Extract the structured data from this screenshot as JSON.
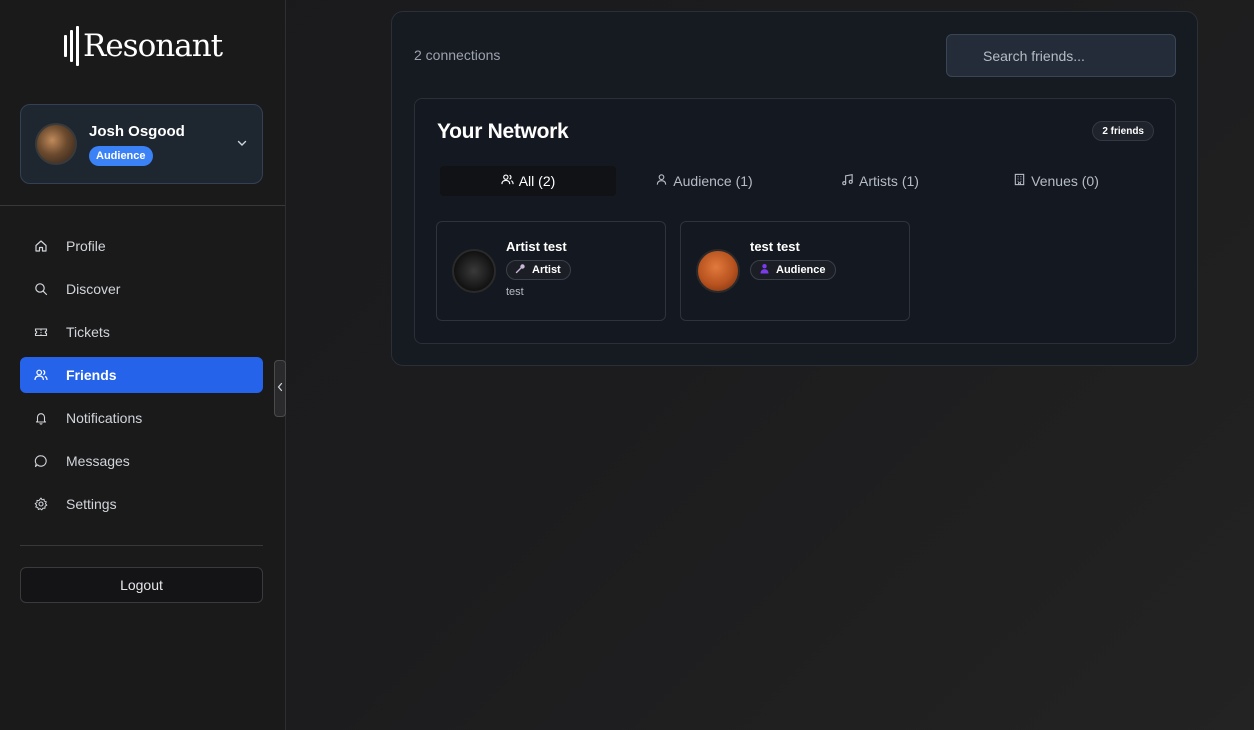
{
  "app": {
    "logo_text": "Resonant"
  },
  "user": {
    "name": "Josh Osgood",
    "role": "Audience"
  },
  "nav": {
    "items": [
      {
        "label": "Profile",
        "icon": "home-icon"
      },
      {
        "label": "Discover",
        "icon": "search-icon"
      },
      {
        "label": "Tickets",
        "icon": "ticket-icon"
      },
      {
        "label": "Friends",
        "icon": "users-icon",
        "active": true
      },
      {
        "label": "Notifications",
        "icon": "bell-icon"
      },
      {
        "label": "Messages",
        "icon": "message-icon"
      },
      {
        "label": "Settings",
        "icon": "gear-icon"
      }
    ],
    "logout_label": "Logout"
  },
  "main": {
    "connections_text": "2 connections",
    "search_placeholder": "Search friends...",
    "network_title": "Your Network",
    "friends_badge": "2 friends",
    "tabs": [
      {
        "label": "All (2)",
        "icon": "users-icon",
        "active": true
      },
      {
        "label": "Audience (1)",
        "icon": "user-icon"
      },
      {
        "label": "Artists (1)",
        "icon": "music-note-icon"
      },
      {
        "label": "Venues (0)",
        "icon": "building-icon"
      }
    ],
    "friends": [
      {
        "name": "Artist test",
        "role": "Artist",
        "role_icon": "microphone-icon",
        "description": "test"
      },
      {
        "name": "test test",
        "role": "Audience",
        "role_icon": "person-icon",
        "description": ""
      }
    ]
  },
  "colors": {
    "accent": "#2563eb",
    "badge_blue": "#3b82f6",
    "background": "#1c1c1e"
  }
}
